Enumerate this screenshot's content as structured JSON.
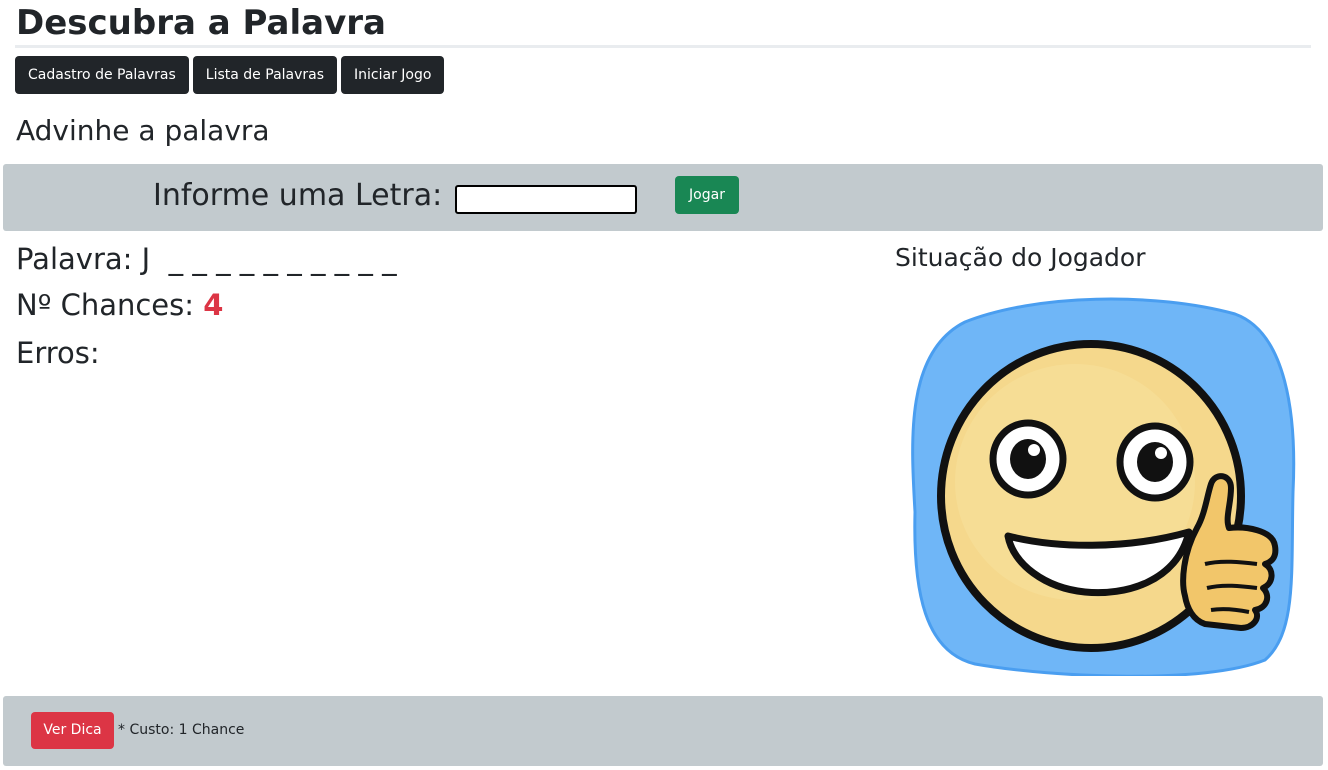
{
  "header": {
    "title": "Descubra a Palavra"
  },
  "nav": {
    "items": [
      {
        "label": "Cadastro de Palavras"
      },
      {
        "label": "Lista de Palavras"
      },
      {
        "label": "Iniciar Jogo"
      }
    ]
  },
  "game": {
    "heading": "Advinhe a palavra",
    "letter_label": "Informe uma Letra:",
    "letter_value": "",
    "play_label": "Jogar",
    "word_label": "Palavra:",
    "word_display": "J  _ _ _ _ _ _ _ _ _ _",
    "chances_label": "Nº Chances:",
    "chances_value": "4",
    "errors_label": "Erros:",
    "errors_value": ""
  },
  "player_status": {
    "heading": "Situação do Jogador",
    "image_icon": "smiley-thumbs-up-icon"
  },
  "hint": {
    "button_label": "Ver Dica",
    "cost_text": "* Custo: 1 Chance"
  },
  "colors": {
    "dark_button": "#212529",
    "success_button": "#198754",
    "danger": "#dc3545",
    "panel_bg": "#c2cace",
    "face_bg_blue": "#6fb6f7",
    "face_yellow": "#f2cf7a"
  }
}
